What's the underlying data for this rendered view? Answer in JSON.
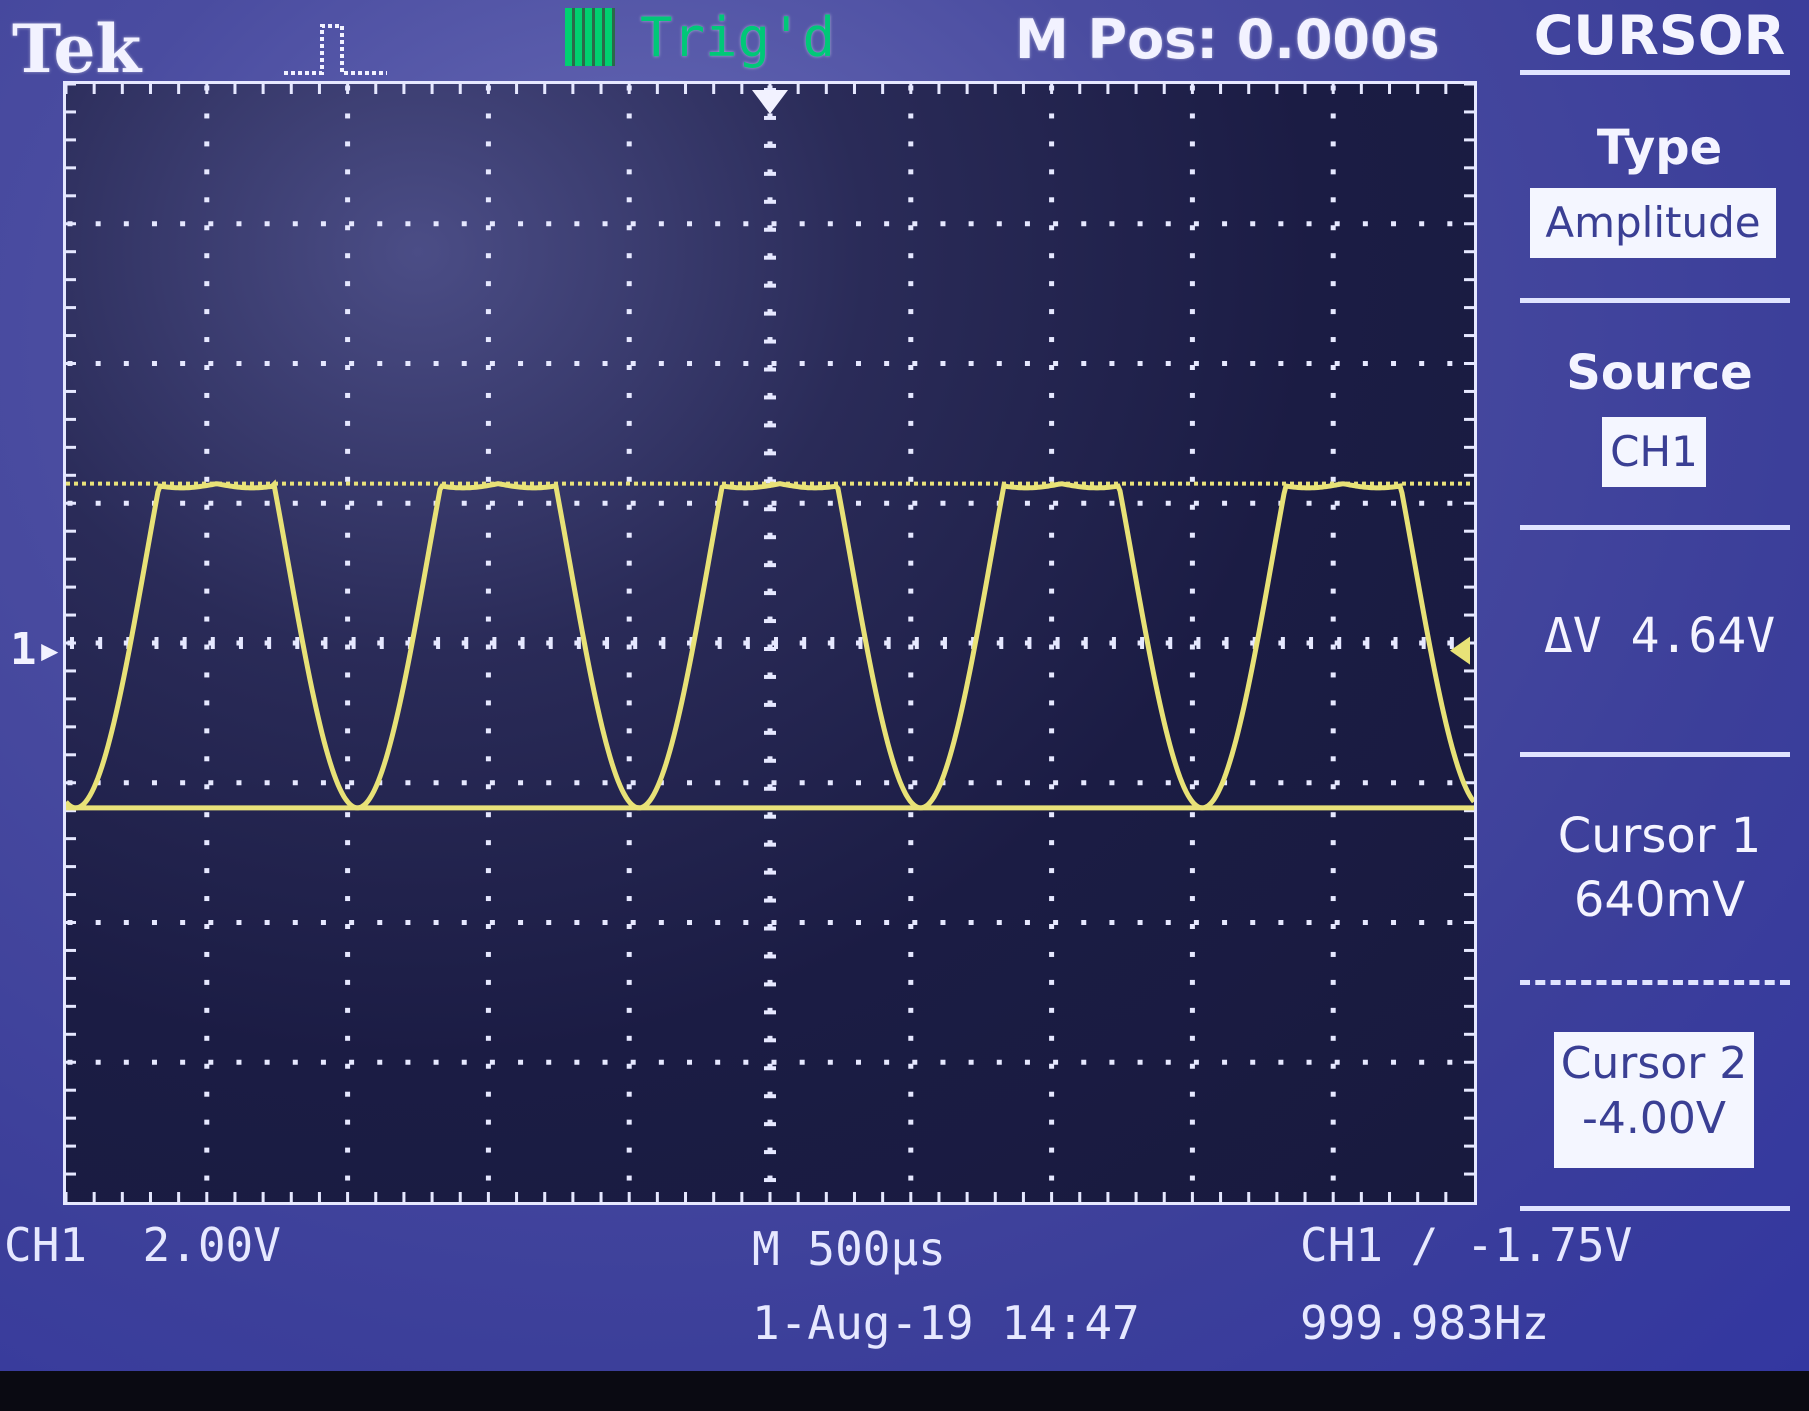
{
  "header": {
    "brand": "Tek",
    "trigger_status": "Trig'd",
    "main_position": "M Pos: 0.000s",
    "menu_title": "CURSOR"
  },
  "menu": {
    "type_label": "Type",
    "type_value": "Amplitude",
    "source_label": "Source",
    "source_value": "CH1",
    "delta_v": "ΔV 4.64V",
    "cursor1_label": "Cursor 1",
    "cursor1_value": "640mV",
    "cursor2_label": "Cursor 2",
    "cursor2_value": "-4.00V"
  },
  "status_bar": {
    "ch1_scale": "CH1  2.00V",
    "timebase": "M 500µs",
    "trigger_setting": "CH1 ∕ -1.75V",
    "date_time": "1-Aug-19 14:47",
    "frequency": "999.983Hz"
  },
  "channel_marker": "1",
  "colors": {
    "screen_bg": "#3c3f9a",
    "graticule_bg": "#1b1c44",
    "trace": "#e6e07a",
    "trig_green": "#00d070",
    "text": "#f2f2ff"
  },
  "waveform": {
    "volts_per_div": 2.0,
    "time_per_div_us": 500,
    "frequency_hz": 999.983,
    "cursor1_v": 0.64,
    "cursor2_v": -4.0,
    "signal_max_v": 0.64,
    "signal_min_v": -4.0,
    "shape": "clipped sine (positive peaks flattened)"
  }
}
